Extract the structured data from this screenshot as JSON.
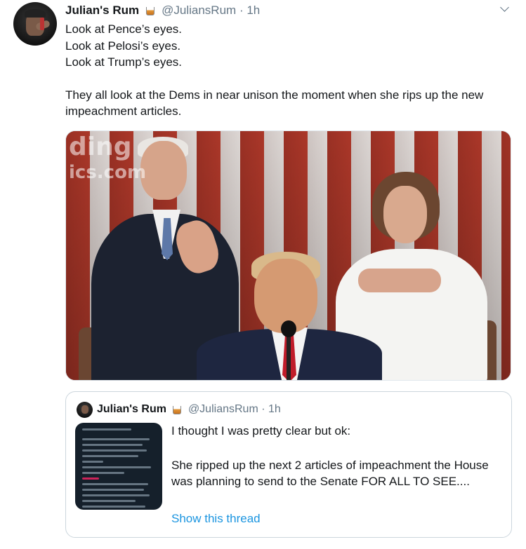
{
  "tweet": {
    "author_name": "Julian's Rum",
    "handle": "@JuliansRum",
    "separator": "·",
    "time": "1h",
    "name_emoji": "tumbler-glass-icon",
    "lines": [
      "Look at Pence’s eyes.",
      "Look at Pelosi’s eyes.",
      "Look at Trump’s eyes."
    ],
    "paragraph": "They all look at the Dems in near unison the moment when she rips up the new impeachment articles.",
    "media": {
      "watermark_line1": "ding",
      "watermark_line2": "ics.com"
    }
  },
  "quoted": {
    "author_name": "Julian's Rum",
    "handle": "@JuliansRum",
    "separator": "·",
    "time": "1h",
    "line1": "I thought I was pretty clear but ok:",
    "paragraph": "She ripped up the next 2 articles of impeachment the House was planning to send to the Senate FOR ALL TO SEE....",
    "show_thread": "Show this thread"
  },
  "colors": {
    "link": "#1b95e0",
    "secondary_text": "#657786",
    "border": "#ccd6dd"
  }
}
